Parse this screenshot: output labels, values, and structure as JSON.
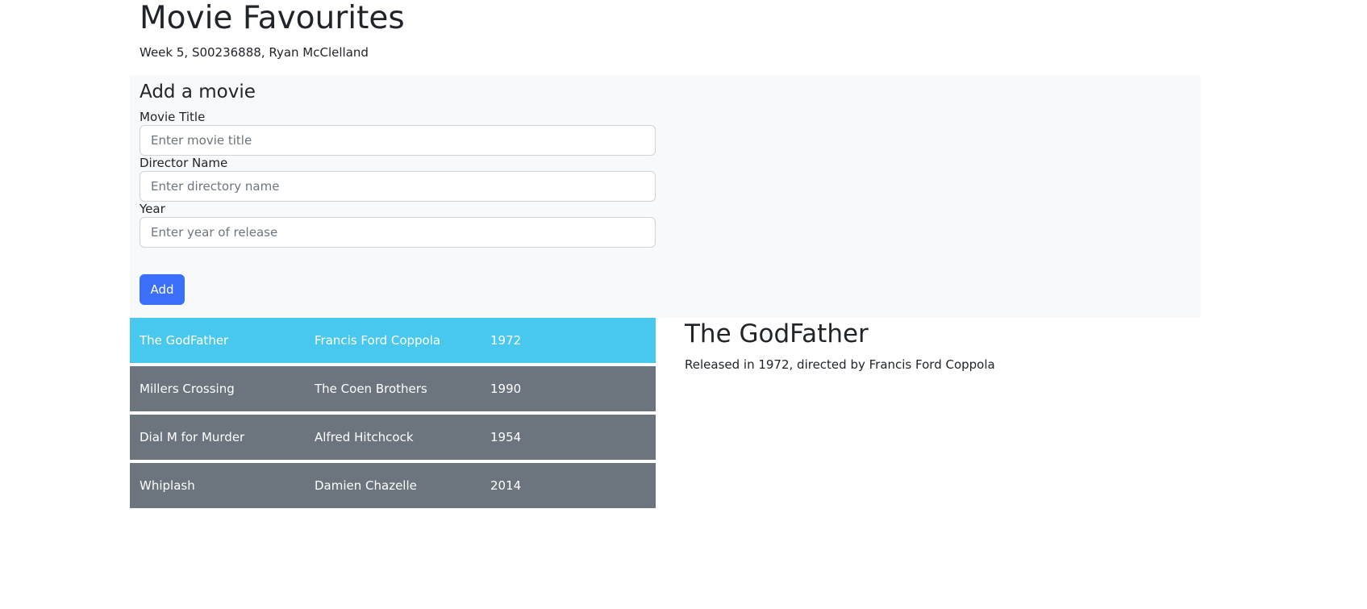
{
  "header": {
    "title": "Movie Favourites",
    "subtitle": "Week 5, S00236888, Ryan McClelland"
  },
  "form": {
    "heading": "Add a movie",
    "title_label": "Movie Title",
    "title_placeholder": "Enter movie title",
    "title_value": "",
    "director_label": "Director Name",
    "director_placeholder": "Enter directory name",
    "director_value": "",
    "year_label": "Year",
    "year_placeholder": "Enter year of release",
    "year_value": "",
    "add_label": "Add"
  },
  "movies": [
    {
      "title": "The GodFather",
      "director": "Francis Ford Coppola",
      "year": "1972",
      "selected": true
    },
    {
      "title": "Millers Crossing",
      "director": "The Coen Brothers",
      "year": "1990",
      "selected": false
    },
    {
      "title": "Dial M for Murder",
      "director": "Alfred Hitchcock",
      "year": "1954",
      "selected": false
    },
    {
      "title": "Whiplash",
      "director": "Damien Chazelle",
      "year": "2014",
      "selected": false
    }
  ],
  "detail": {
    "title": "The GodFather",
    "description": "Released in 1972, directed by Francis Ford Coppola"
  },
  "colors": {
    "selected_row": "#48c8ef",
    "row": "#6c757d",
    "primary_button": "#3b6ef9",
    "panel_background": "#f8f9fa"
  }
}
